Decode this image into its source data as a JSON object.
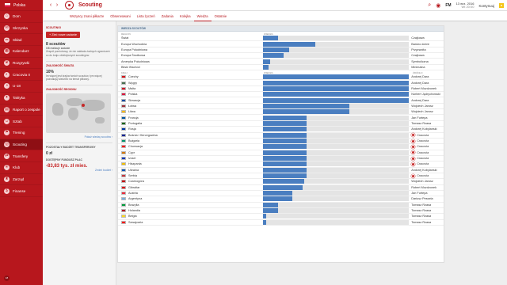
{
  "sidebar": {
    "country": "Polska",
    "version": "18",
    "items": [
      {
        "label": "Dom",
        "icon": "home-icon",
        "glyph": "⌂"
      },
      {
        "label": "Skrzynka",
        "icon": "inbox-icon",
        "glyph": "✉"
      },
      {
        "label": "Skład",
        "icon": "squad-icon",
        "glyph": "☰"
      },
      {
        "label": "Kalendarz",
        "icon": "calendar-icon",
        "glyph": "▦"
      },
      {
        "label": "Rozgrywki",
        "icon": "competitions-icon",
        "glyph": "♛"
      },
      {
        "label": "Cracovia II",
        "icon": "team-icon",
        "glyph": "◐"
      },
      {
        "label": "U-18",
        "icon": "youth-icon",
        "glyph": "◑"
      },
      {
        "label": "Taktyka",
        "icon": "tactics-icon",
        "glyph": "✦"
      },
      {
        "label": "Raport o zespole",
        "icon": "report-icon",
        "glyph": "▤"
      },
      {
        "label": "Sztab",
        "icon": "staff-icon",
        "glyph": "☺"
      },
      {
        "label": "Trening",
        "icon": "training-icon",
        "glyph": "⚑"
      },
      {
        "label": "Scouting",
        "icon": "scouting-icon",
        "glyph": "◎",
        "active": true
      },
      {
        "label": "Transfery",
        "icon": "transfers-icon",
        "glyph": "⇄"
      },
      {
        "label": "Klub",
        "icon": "club-icon",
        "glyph": "⛨"
      },
      {
        "label": "Zarząd",
        "icon": "board-icon",
        "glyph": "♜"
      },
      {
        "label": "Finanse",
        "icon": "finance-icon",
        "glyph": "$"
      }
    ]
  },
  "topbar": {
    "title": "Scouting",
    "date_line1": "13 wrz. 2016",
    "date_line2": "Wt 20:00",
    "continue": "Kontynuuj"
  },
  "tabs": [
    "Wszyscy znani piłkarze",
    "Obserwowani",
    "Lista życzeń",
    "Zadania",
    "Kolejka",
    "Wiedza",
    "Ostatnie"
  ],
  "active_tab": "Wiedza",
  "left": {
    "scouting_header": "SCOUTINGI",
    "new_task": "Zleć nowe zadanie",
    "count": "8 scoutów",
    "busy": "0/8 realizuje zadanie",
    "desc": "Zespół pomiotrowy, że nie nakłada żadnych ograniczeń co do kraju obiektywnych scoutingów.",
    "world_header": "ZNAJOMOŚĆ ŚWIATA",
    "world_pct": "10%",
    "world_desc": "Im więcej jest krajów twoich scoutów, tym więcej pozwalają wiedzieć na temat piłkarzy.",
    "region_header": "ZNAJOMOŚĆ REGIONU",
    "region_link": "Pokaż wiedzę scoutów ›",
    "budget_label": "POZOSTAŁY BUDŻET TRANSFEROWY",
    "budget": "0 zł",
    "wage_label": "DOSTĘPNY FUNDUSZ PŁAC",
    "wage": "-83,83 tys. zł mies.",
    "budget_link": "Zmień budżet ›"
  },
  "main": {
    "header": "WIEDZA SCOUTÓW",
    "region_cols": [
      "REGION",
      "WIEDZA",
      ""
    ],
    "regions": [
      {
        "name": "Świat",
        "pct": 10,
        "who": "Czajkowa"
      },
      {
        "name": "Europa Wschodnia",
        "pct": 36,
        "who": "Bardzo dobre"
      },
      {
        "name": "Europa Południowa",
        "pct": 18,
        "who": "Przyzwoita"
      },
      {
        "name": "Europa Środkowa",
        "pct": 14,
        "who": "Czajkowa"
      },
      {
        "name": "Ameryka Południowa",
        "pct": 5,
        "who": "Symboliczna"
      },
      {
        "name": "Bliski Wschód",
        "pct": 4,
        "who": "Minimalna"
      }
    ],
    "country_cols": [
      "KRAJ",
      "WIEDZA",
      "ŹRÓDŁO"
    ],
    "countries": [
      {
        "name": "Czechy",
        "pct": 100,
        "who": "Andrzej Dara",
        "flag": "#d7141a",
        "club": false
      },
      {
        "name": "Węgry",
        "pct": 100,
        "who": "Andrzej Dara",
        "flag": "#477050",
        "club": false
      },
      {
        "name": "Malta",
        "pct": 100,
        "who": "Robert Mozdzonek",
        "flag": "#cf142b",
        "club": false
      },
      {
        "name": "Polska",
        "pct": 100,
        "who": "Norbert Jędrychowski",
        "flag": "#dc143c",
        "club": false
      },
      {
        "name": "Słowacja",
        "pct": 100,
        "who": "Andrzej Dara",
        "flag": "#0b4ea2",
        "club": false
      },
      {
        "name": "Łotwa",
        "pct": 59,
        "who": "Wojciech Jarosz",
        "flag": "#9e3039",
        "club": false
      },
      {
        "name": "Litwa",
        "pct": 59,
        "who": "Wojciech Jarosz",
        "flag": "#fdb913",
        "club": false
      },
      {
        "name": "Francja",
        "pct": 30,
        "who": "Jan Furtepa",
        "flag": "#0055a4",
        "club": false
      },
      {
        "name": "Portugalia",
        "pct": 30,
        "who": "Tomasz Rzasa",
        "flag": "#006600",
        "club": false
      },
      {
        "name": "Rosja",
        "pct": 30,
        "who": "Andrzej Kobylański",
        "flag": "#0039a6",
        "club": false
      },
      {
        "name": "Bośnia i Hercegowina",
        "pct": 30,
        "who": "Cracovia",
        "flag": "#002395",
        "club": true
      },
      {
        "name": "Bułgaria",
        "pct": 30,
        "who": "Cracovia",
        "flag": "#00966e",
        "club": true
      },
      {
        "name": "Chorwacja",
        "pct": 30,
        "who": "Cracovia",
        "flag": "#ff0000",
        "club": true
      },
      {
        "name": "Cypr",
        "pct": 30,
        "who": "Cracovia",
        "flag": "#d57800",
        "club": true
      },
      {
        "name": "Izrael",
        "pct": 30,
        "who": "Cracovia",
        "flag": "#0038b8",
        "club": true
      },
      {
        "name": "Hiszpania",
        "pct": 30,
        "who": "Cracovia",
        "flag": "#f1bf00",
        "club": true
      },
      {
        "name": "Ukraina",
        "pct": 30,
        "who": "Andrzej Kobylański",
        "flag": "#0057b7",
        "club": false
      },
      {
        "name": "Serbia",
        "pct": 30,
        "who": "Cracovia",
        "flag": "#c6363c",
        "club": true
      },
      {
        "name": "Czarnogóra",
        "pct": 28,
        "who": "Wojciech Jarosz",
        "flag": "#c40308",
        "club": false
      },
      {
        "name": "Gibraltar",
        "pct": 27,
        "who": "Robert Mozdzonek",
        "flag": "#da000c",
        "club": false
      },
      {
        "name": "Austria",
        "pct": 20,
        "who": "Jan Furtepa",
        "flag": "#ed2939",
        "club": false
      },
      {
        "name": "Argentyna",
        "pct": 20,
        "who": "Dariusz Pessela",
        "flag": "#74acdf",
        "club": false
      },
      {
        "name": "Brazylia",
        "pct": 10,
        "who": "Tomasz Rzasa",
        "flag": "#009c3b",
        "club": false
      },
      {
        "name": "Holandia",
        "pct": 10,
        "who": "Tomasz Rzasa",
        "flag": "#ae1c28",
        "club": false
      },
      {
        "name": "Belgia",
        "pct": 2,
        "who": "Tomasz Rzasa",
        "flag": "#fdda24",
        "club": false
      },
      {
        "name": "Szwajcaria",
        "pct": 2,
        "who": "Tomasz Rzasa",
        "flag": "#ff0000",
        "club": false
      }
    ]
  }
}
